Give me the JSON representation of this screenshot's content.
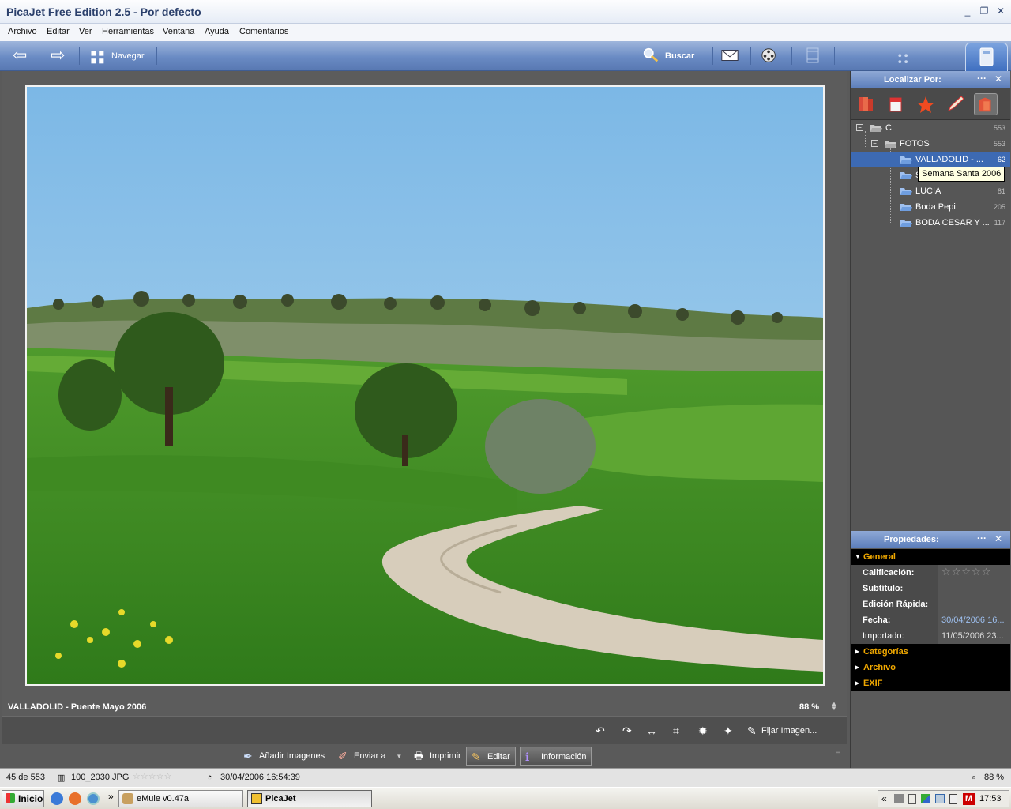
{
  "window": {
    "title": "PicaJet Free Edition 2.5  - Por defecto",
    "controls": {
      "minimize": "_",
      "restore": "❐",
      "close": "✕"
    }
  },
  "menu": [
    "Archivo",
    "Editar",
    "Ver",
    "Herramientas",
    "Ventana",
    "Ayuda",
    "Comentarios"
  ],
  "toolbar": {
    "navigate_label": "Navegar",
    "search_label": "Buscar"
  },
  "viewer": {
    "caption": "VALLADOLID - Puente Mayo 2006",
    "zoom": "88 %"
  },
  "edit_tools": {
    "fix_image_label": "Fijar Imagen..."
  },
  "mode_buttons": {
    "add_images": "Añadir Imagenes",
    "send_to": "Enviar a",
    "print": "Imprimir",
    "edit": "Editar",
    "info": "Información"
  },
  "status": {
    "position": "45 de 553",
    "filename": "100_2030.JPG",
    "stars": "☆☆☆☆☆",
    "datetime": "30/04/2006 16:54:39",
    "zoom": "88 %"
  },
  "locate_panel": {
    "title": "Localizar Por:",
    "dots": "···",
    "close": "✕",
    "tree": [
      {
        "label": "C:",
        "count": "553"
      },
      {
        "label": "FOTOS",
        "count": "553"
      },
      {
        "label": "VALLADOLID - ...",
        "count": "62"
      },
      {
        "label": "S",
        "count": "88"
      },
      {
        "label": "LUCIA",
        "count": "81"
      },
      {
        "label": "Boda Pepi",
        "count": "205"
      },
      {
        "label": "BODA CESAR Y ...",
        "count": "117"
      }
    ],
    "tooltip": "Semana Santa 2006"
  },
  "properties_panel": {
    "title": "Propiedades:",
    "dots": "···",
    "close": "✕",
    "section_general": "General",
    "rows": [
      {
        "key": "Calificación:",
        "value": "☆☆☆☆☆"
      },
      {
        "key": "Subtítulo:",
        "value": ""
      },
      {
        "key": "Edición Rápida:",
        "value": ""
      },
      {
        "key": "Fecha:",
        "value": "30/04/2006 16..."
      },
      {
        "key": "Importado:",
        "value": "11/05/2006 23..."
      }
    ],
    "sections": [
      "Categorías",
      "Archivo",
      "EXIF"
    ]
  },
  "taskbar": {
    "start": "Inicio",
    "chevron": "»",
    "tasks": [
      "eMule v0.47a",
      "PicaJet"
    ],
    "tray_chevron": "«",
    "clock": "17:53"
  },
  "colors": {
    "accent_blue": "#5b7dba",
    "selection": "#3d6ab3",
    "section_text": "#f0a800"
  }
}
